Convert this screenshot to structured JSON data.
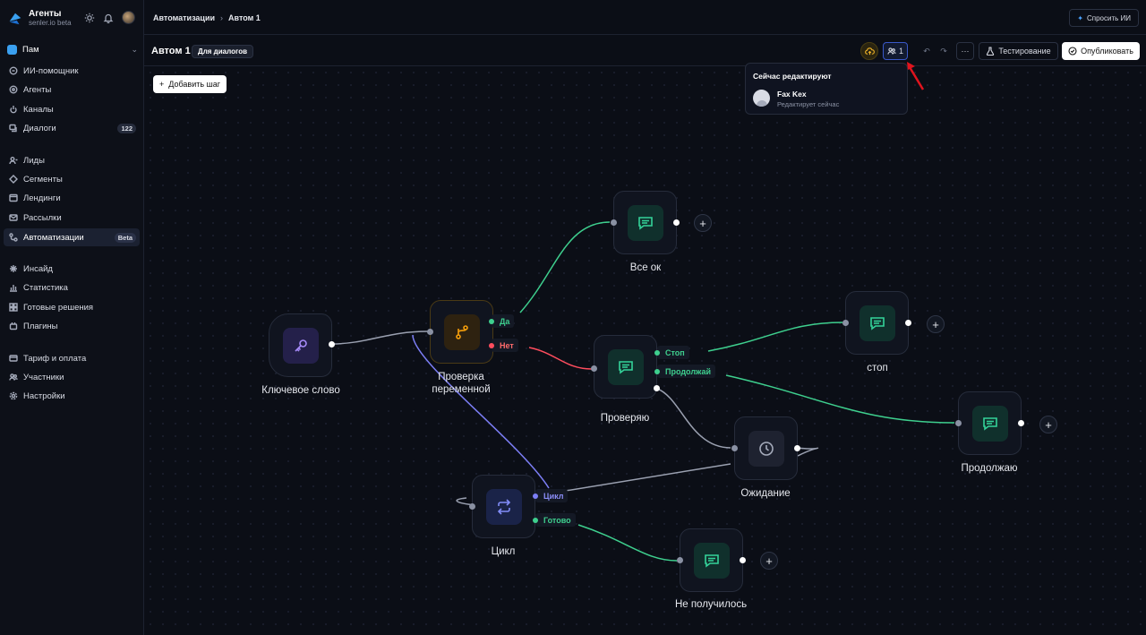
{
  "brand": {
    "title": "Агенты",
    "subtitle": "senler.io beta"
  },
  "workspace": {
    "name": "Пам"
  },
  "sidebar": {
    "group1": [
      {
        "label": "ИИ-помощник",
        "icon": "assistant-icon"
      },
      {
        "label": "Агенты",
        "icon": "agents-icon"
      },
      {
        "label": "Каналы",
        "icon": "channels-icon"
      },
      {
        "label": "Диалоги",
        "icon": "dialogs-icon",
        "badge": "122"
      }
    ],
    "group2": [
      {
        "label": "Лиды",
        "icon": "leads-icon"
      },
      {
        "label": "Сегменты",
        "icon": "segments-icon"
      },
      {
        "label": "Лендинги",
        "icon": "landings-icon"
      },
      {
        "label": "Рассылки",
        "icon": "mailings-icon"
      },
      {
        "label": "Автоматизации",
        "icon": "automations-icon",
        "badge": "Beta",
        "active": true
      }
    ],
    "group3": [
      {
        "label": "Инсайд",
        "icon": "insight-icon"
      },
      {
        "label": "Статистика",
        "icon": "stats-icon"
      },
      {
        "label": "Готовые решения",
        "icon": "solutions-icon"
      },
      {
        "label": "Плагины",
        "icon": "plugins-icon"
      }
    ],
    "group4": [
      {
        "label": "Тариф и оплата",
        "icon": "billing-icon"
      },
      {
        "label": "Участники",
        "icon": "members-icon"
      },
      {
        "label": "Настройки",
        "icon": "settings-icon"
      }
    ]
  },
  "breadcrumb": {
    "parent": "Автоматизации",
    "current": "Автом 1"
  },
  "header": {
    "ask_ai": "Спросить ИИ"
  },
  "flow": {
    "title": "Автом 1",
    "tag": "Для диалогов",
    "users_count": "1",
    "test_label": "Тестирование",
    "publish_label": "Опубликовать",
    "add_step": "Добавить шаг"
  },
  "popover": {
    "title": "Сейчас редактируют",
    "user_name": "Fax Kex",
    "user_status": "Редактирует сейчас"
  },
  "nodes": {
    "keyword": "Ключевое слово",
    "condition_line1": "Проверка",
    "condition_line2": "переменной",
    "ok": "Все ок",
    "check": "Проверяю",
    "stop": "стоп",
    "continue": "Продолжаю",
    "wait": "Ожидание",
    "loop": "Цикл",
    "failed": "Не получилось"
  },
  "branches": {
    "yes": "Да",
    "no": "Нет",
    "stop": "Стоп",
    "continue": "Продолжай",
    "loop": "Цикл",
    "done": "Готово"
  },
  "colors": {
    "accent_green": "#3ecf8e",
    "accent_red": "#ff4d5e",
    "accent_purple": "#7c7ef5",
    "wire_gray": "#9aa0b0"
  }
}
